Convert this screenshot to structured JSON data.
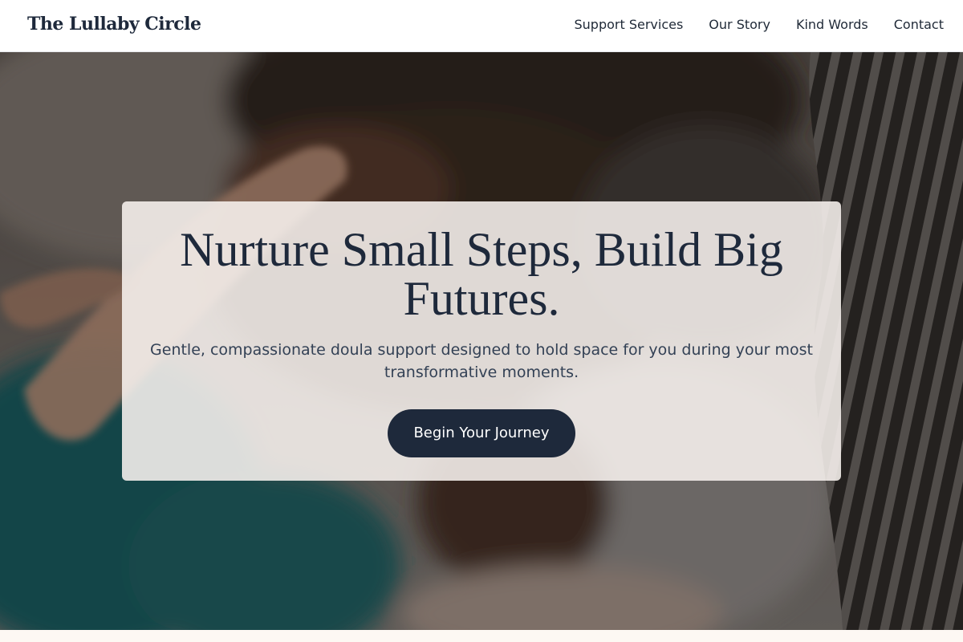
{
  "header": {
    "brand": "The Lullaby Circle",
    "nav": [
      {
        "label": "Support Services"
      },
      {
        "label": "Our Story"
      },
      {
        "label": "Kind Words"
      },
      {
        "label": "Contact"
      }
    ]
  },
  "hero": {
    "title": "Nurture Small Steps, Build Big Futures.",
    "subtitle": "Gentle, compassionate doula support designed to hold space for you during your most transformative moments.",
    "cta_label": "Begin Your Journey"
  },
  "colors": {
    "primary_navy": "#1e293b",
    "card_bg": "#f8f3ef",
    "page_bg": "#fdf8f3"
  }
}
